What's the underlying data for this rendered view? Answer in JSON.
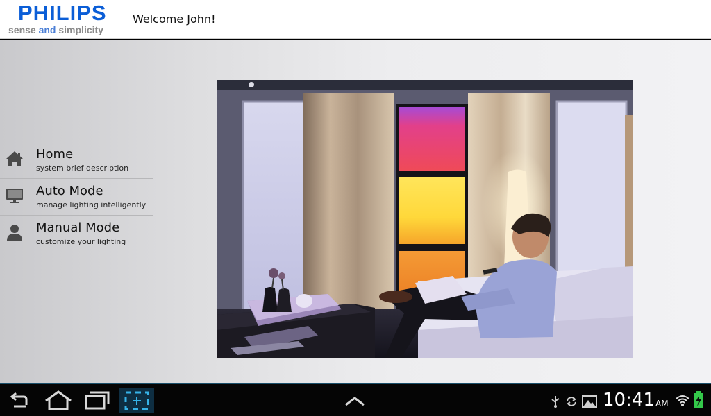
{
  "header": {
    "brand": "PHILIPS",
    "tagline": {
      "part1": "sense ",
      "part2": "and",
      "part3": " simplicity"
    },
    "welcome": "Welcome John!",
    "brand_color": "#0b5ed7"
  },
  "menu": {
    "items": [
      {
        "icon": "home-icon",
        "title": "Home",
        "subtitle": "system brief description"
      },
      {
        "icon": "monitor-icon",
        "title": "Auto Mode",
        "subtitle": "manage lighting intelligently"
      },
      {
        "icon": "person-icon",
        "title": "Manual Mode",
        "subtitle": "customize your lighting"
      }
    ]
  },
  "photo": {
    "subject": "living-room-photo"
  },
  "navbar": {
    "buttons": [
      "back-icon",
      "home-icon",
      "recent-apps-icon",
      "screenshot-icon",
      "chevron-up-icon"
    ],
    "status_icons": [
      "usb-icon",
      "sync-icon",
      "gallery-icon",
      "wifi-icon",
      "battery-icon"
    ],
    "time": "10:41",
    "ampm": "AM"
  }
}
